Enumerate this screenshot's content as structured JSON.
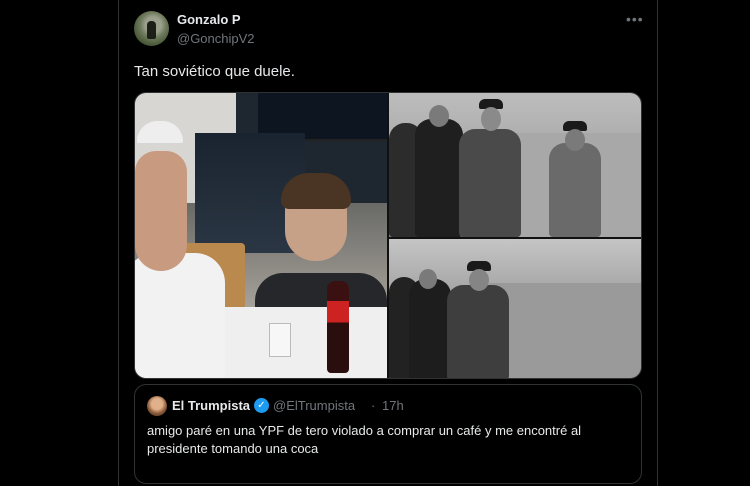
{
  "tweet": {
    "author": {
      "display_name": "Gonzalo P",
      "handle": "@GonchipV2",
      "avatar_icon": "user-avatar"
    },
    "more_icon": "more-options-icon",
    "text": "Tan soviético que duele.",
    "media": [
      {
        "name": "selfie-photo"
      },
      {
        "name": "historical-photo-original"
      },
      {
        "name": "historical-photo-edited"
      }
    ]
  },
  "quoted_tweet": {
    "display_name": "El Trumpista",
    "verified_icon": "verified-badge-icon",
    "handle": "@ElTrumpista",
    "separator": "·",
    "time": "17h",
    "text": "amigo paré en una YPF de tero violado a comprar un café y me encontré al presidente tomando una coca"
  },
  "colors": {
    "background": "#000000",
    "text_primary": "#e7e9ea",
    "text_secondary": "#71767b",
    "border": "#2f3336",
    "verified": "#1d9bf0"
  }
}
